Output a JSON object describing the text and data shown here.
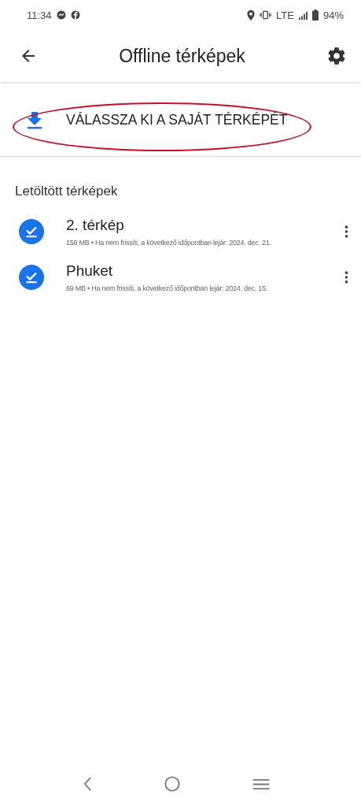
{
  "status_bar": {
    "time": "11:34",
    "network": "LTE",
    "battery": "94%"
  },
  "app_bar": {
    "title": "Offline térképek"
  },
  "select_map": {
    "label": "VÁLASSZA KI A SAJÁT TÉRKÉPÉT",
    "annotated": true
  },
  "section_title": "Letöltött térképek",
  "maps": [
    {
      "name": "2. térkép",
      "details": "158 MB • Ha nem frissíti, a következő időpontban lejár: 2024. dec. 21."
    },
    {
      "name": "Phuket",
      "details": "69 MB • Ha nem frissíti, a következő időpontban lejár: 2024. dec. 15."
    }
  ]
}
